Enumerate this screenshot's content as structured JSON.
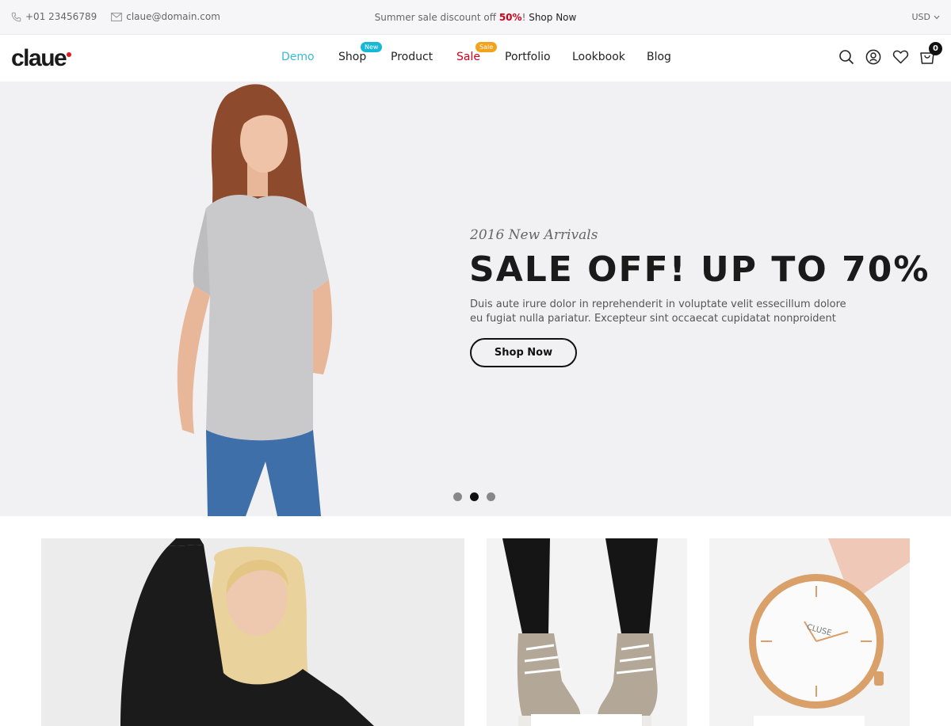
{
  "topbar": {
    "phone": "+01 23456789",
    "email": "claue@domain.com",
    "promo_text": "Summer sale discount off",
    "promo_highlight": "50%",
    "promo_sep": "!",
    "promo_link": "Shop Now",
    "currency": "USD"
  },
  "header": {
    "logo": "claue",
    "nav": [
      {
        "label": "Demo"
      },
      {
        "label": "Shop",
        "badge": "New"
      },
      {
        "label": "Product"
      },
      {
        "label": "Sale",
        "badge": "Sale"
      },
      {
        "label": "Portfolio"
      },
      {
        "label": "Lookbook"
      },
      {
        "label": "Blog"
      }
    ],
    "cart_count": "0"
  },
  "hero": {
    "subtitle": "2016 New Arrivals",
    "title": "SALE OFF! UP TO 70%",
    "description_line1": "Duis aute irure dolor in reprehenderit in voluptate velit essecillum dolore",
    "description_line2": "eu fugiat nulla pariatur. Excepteur sint occaecat cupidatat nonproident",
    "cta": "Shop Now",
    "slides": 3,
    "active_slide": 2
  },
  "tiles": {
    "watch_brand": "CLUSE"
  },
  "colors": {
    "accent": "#3bb8d6",
    "sale": "#d0021b",
    "badge_new": "#15b8d6",
    "badge_sale": "#f4a11c",
    "hero_bg": "#f1f1f3"
  }
}
